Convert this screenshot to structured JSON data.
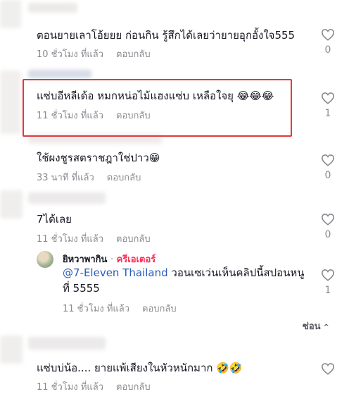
{
  "comments": [
    {
      "text": "ตอนยายเลาโอ้ยยย ก่อนกิน รู้สึกได้เลยว่ายายอุกอั้งใจ555",
      "time": "10 ชั่วโมง ที่แล้ว",
      "reply": "ตอบกลับ",
      "likes": "0"
    },
    {
      "text": "แซ่บอีหลีเด้อ หมกหน่อไม้แฮงแซ่บ เหลือใจยุ 😂😂😂",
      "time": "11 ชั่วโมง ที่แล้ว",
      "reply": "ตอบกลับ",
      "likes": "1"
    },
    {
      "text": "ใช้ผงชูรสตราชฎาใช่ปาว😁",
      "time": "33 นาที ที่แล้ว",
      "reply": "ตอบกลับ",
      "likes": "0"
    },
    {
      "text": "7ได้เลย",
      "time": "11 ชั่วโมง ที่แล้ว",
      "reply": "ตอบกลับ",
      "likes": "0"
    },
    {
      "text": "แซ่บบ่น้อ.... ยายแพ้เสียงในหัวหนักมาก 🤣🤣",
      "time": "11 ชั่วโมง ที่แล้ว",
      "reply": "ตอบกลับ",
      "likes": ""
    }
  ],
  "creator_reply": {
    "author": "ยิหวาพากิน",
    "separator": "·",
    "badge": "ครีเอเตอร์",
    "mention": "@7-Eleven Thailand",
    "text_line1": " วอนเซเว่นเห็นคลิปนี้สปอนหนู",
    "text_line2": "ที่ 5555",
    "time": "11 ชั่วโมง ที่แล้ว",
    "reply": "ตอบกลับ",
    "likes": "1"
  },
  "hide_label": "ซ่อน",
  "icons": {
    "like": "heart-outline-icon",
    "hide": "chevron-up-icon"
  },
  "colors": {
    "highlight": "#e03a3a",
    "creator": "#fe2c55",
    "mention": "#2b5db9"
  }
}
